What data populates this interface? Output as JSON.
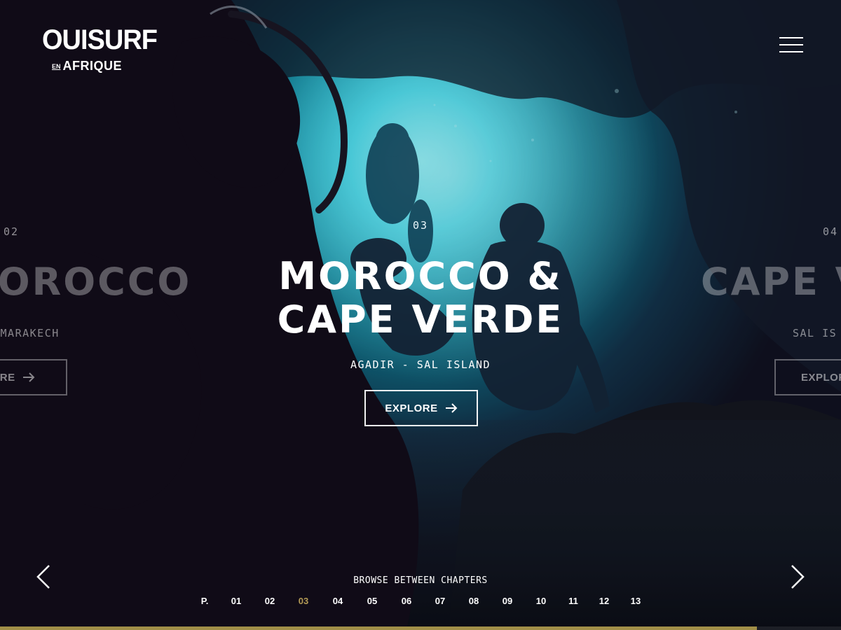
{
  "logo": {
    "main": "OUISURF",
    "sub_small": "EN",
    "sub_large": "AFRIQUE"
  },
  "header": {
    "menu_icon": "hamburger-menu-icon"
  },
  "slides": {
    "previous": {
      "number": "02",
      "title": "MOROCCO",
      "subtitle": "-MARAKECH",
      "button_label": "EXPLORE"
    },
    "current": {
      "number": "03",
      "title_line1": "MOROCCO &",
      "title_line2": "CAPE VERDE",
      "subtitle": "AGADIR - SAL ISLAND",
      "button_label": "EXPLORE",
      "button_icon": "arrow-right-icon"
    },
    "next": {
      "number": "04",
      "title": "CAPE V",
      "subtitle": "SAL IS",
      "button_label": "EXPLOR"
    }
  },
  "navigation": {
    "prev_icon": "chevron-left-icon",
    "next_icon": "chevron-right-icon",
    "browse_label": "BROWSE BETWEEN CHAPTERS",
    "chapters": [
      "P.",
      "01",
      "02",
      "03",
      "04",
      "05",
      "06",
      "07",
      "08",
      "09",
      "10",
      "11",
      "12",
      "13"
    ],
    "active_chapter": "03"
  },
  "progress": {
    "fraction": 0.9
  },
  "colors": {
    "accent": "#b39a55",
    "progress": "#a18f48",
    "water_glow": "#1ee0f5",
    "background_dark": "#0b0a12"
  }
}
